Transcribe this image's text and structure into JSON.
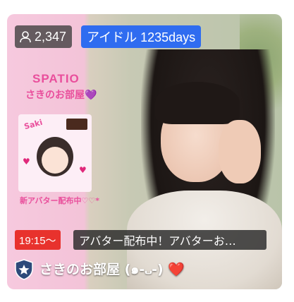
{
  "card": {
    "viewer_count": "2,347",
    "category_tag": "アイドル 1235days",
    "start_time": "19:15～",
    "stream_title": "アバター配布中！アバターお…",
    "room_name": "さきのお部屋 (๑-᎑-) ❤️"
  },
  "poster": {
    "brand": "SPATIO",
    "room_title": "さきのお部屋💜",
    "art_label": "Saki",
    "promo": "新アバター配布中♡♡*"
  },
  "icons": {
    "viewers": "person-icon",
    "official": "star-shield-icon"
  },
  "colors": {
    "tag_blue": "#2f6cf0",
    "time_red": "#e8322d",
    "poster_pink": "#e94f9c"
  }
}
